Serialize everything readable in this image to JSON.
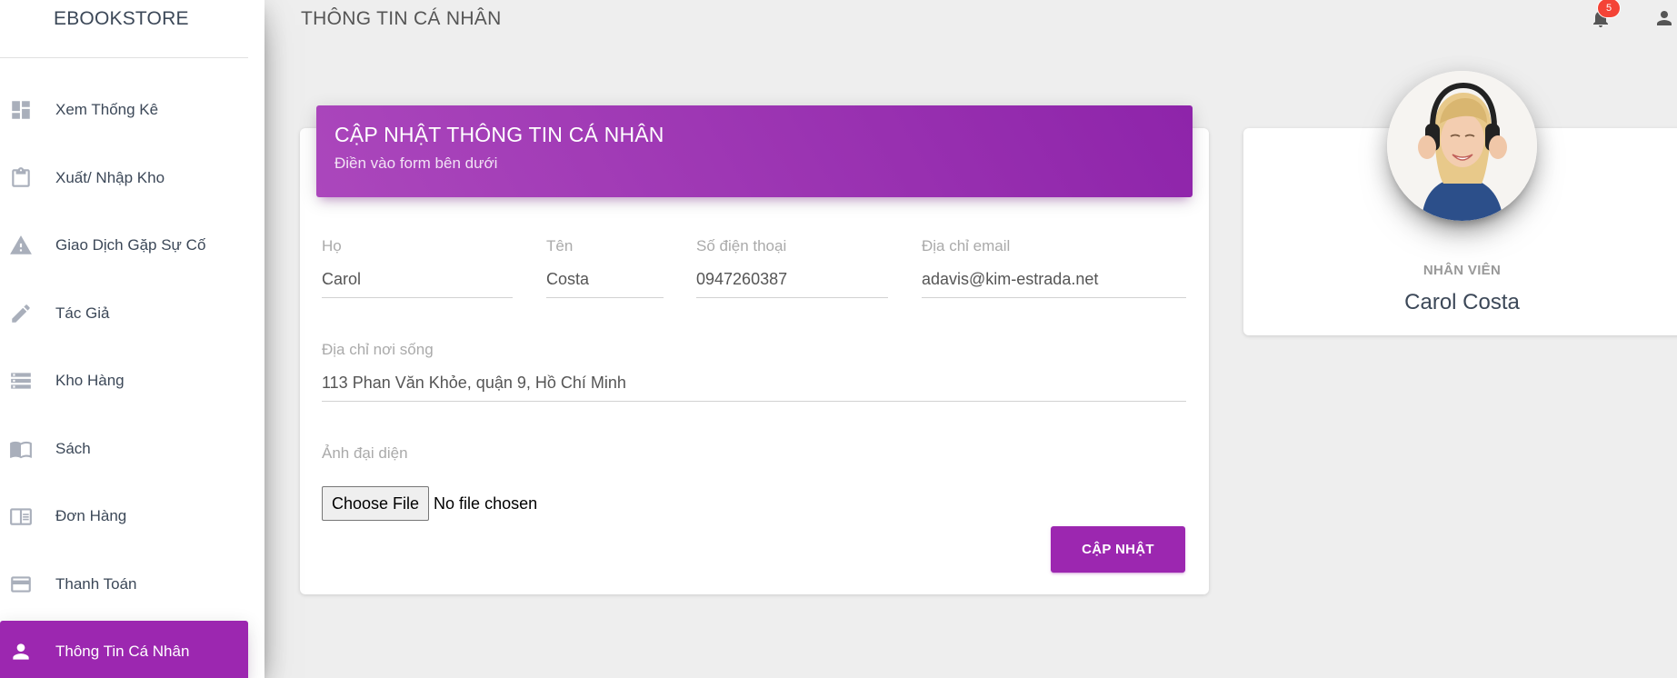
{
  "brand": "EBOOKSTORE",
  "header": {
    "title": "THÔNG TIN CÁ NHÂN",
    "notification_count": "5"
  },
  "sidebar": {
    "items": [
      {
        "label": "Xem Thống Kê",
        "icon": "dashboard-icon"
      },
      {
        "label": "Xuất/ Nhập Kho",
        "icon": "clipboard-icon"
      },
      {
        "label": "Giao Dịch Gặp Sự Cố",
        "icon": "warning-icon"
      },
      {
        "label": "Tác Giả",
        "icon": "pencil-icon"
      },
      {
        "label": "Kho Hàng",
        "icon": "storage-icon"
      },
      {
        "label": "Sách",
        "icon": "book-icon"
      },
      {
        "label": "Đơn Hàng",
        "icon": "orders-icon"
      },
      {
        "label": "Thanh Toán",
        "icon": "credit-card-icon"
      },
      {
        "label": "Thông Tin Cá Nhân",
        "icon": "person-icon",
        "active": true
      }
    ]
  },
  "form": {
    "title": "CẬP NHẬT THÔNG TIN CÁ NHÂN",
    "subtitle": "Điền vào form bên dưới",
    "last_name_label": "Họ",
    "last_name_value": "Carol",
    "first_name_label": "Tên",
    "first_name_value": "Costa",
    "phone_label": "Số điện thoại",
    "phone_value": "0947260387",
    "email_label": "Địa chỉ email",
    "email_value": "adavis@kim-estrada.net",
    "address_label": "Địa chỉ nơi sống",
    "address_value": "113 Phan Văn Khỏe, quận 9, Hồ Chí Minh",
    "avatar_label": "Ảnh đại diện",
    "choose_file_label": "Choose File",
    "file_status": "No file chosen",
    "submit_label": "CẬP NHẬT"
  },
  "profile": {
    "role": "NHÂN VIÊN",
    "name": "Carol Costa"
  },
  "colors": {
    "accent": "#9c27b0",
    "accent_light": "#ab47bc",
    "badge": "#f44336",
    "background": "#eeeeee"
  }
}
